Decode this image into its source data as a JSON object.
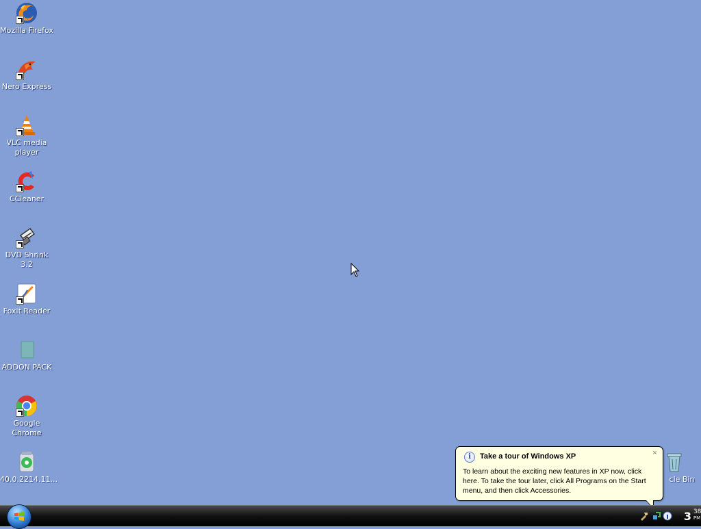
{
  "desktop": {
    "icons": [
      {
        "label": "Mozilla Firefox",
        "icon": "firefox-icon"
      },
      {
        "label": "Nero Express",
        "icon": "nero-icon"
      },
      {
        "label": "VLC media player",
        "icon": "vlc-icon"
      },
      {
        "label": "CCleaner",
        "icon": "ccleaner-icon"
      },
      {
        "label": "DVD Shrink 3.2",
        "icon": "dvd-shrink-icon"
      },
      {
        "label": "Foxit Reader",
        "icon": "foxit-icon"
      },
      {
        "label": "ADDON PACK",
        "icon": "folder-icon"
      },
      {
        "label": "Google Chrome",
        "icon": "chrome-icon"
      },
      {
        "label": "40.0.2214.11...",
        "icon": "installer-icon"
      },
      {
        "label": "cle Bin",
        "icon": "recycle-bin-icon"
      }
    ]
  },
  "balloon": {
    "title": "Take a tour of Windows XP",
    "body": "To learn about the exciting new features in XP now, click here. To take the tour later, click All Programs on the Start menu, and then click Accessories.",
    "close": "×",
    "info": "i"
  },
  "taskbar": {
    "clock_hour": "3",
    "clock_minutes": "38",
    "clock_ampm": "PM"
  },
  "colors": {
    "desktop_bg": "#839fd6",
    "balloon_bg": "#ffffe1",
    "taskbar": "#111111"
  }
}
